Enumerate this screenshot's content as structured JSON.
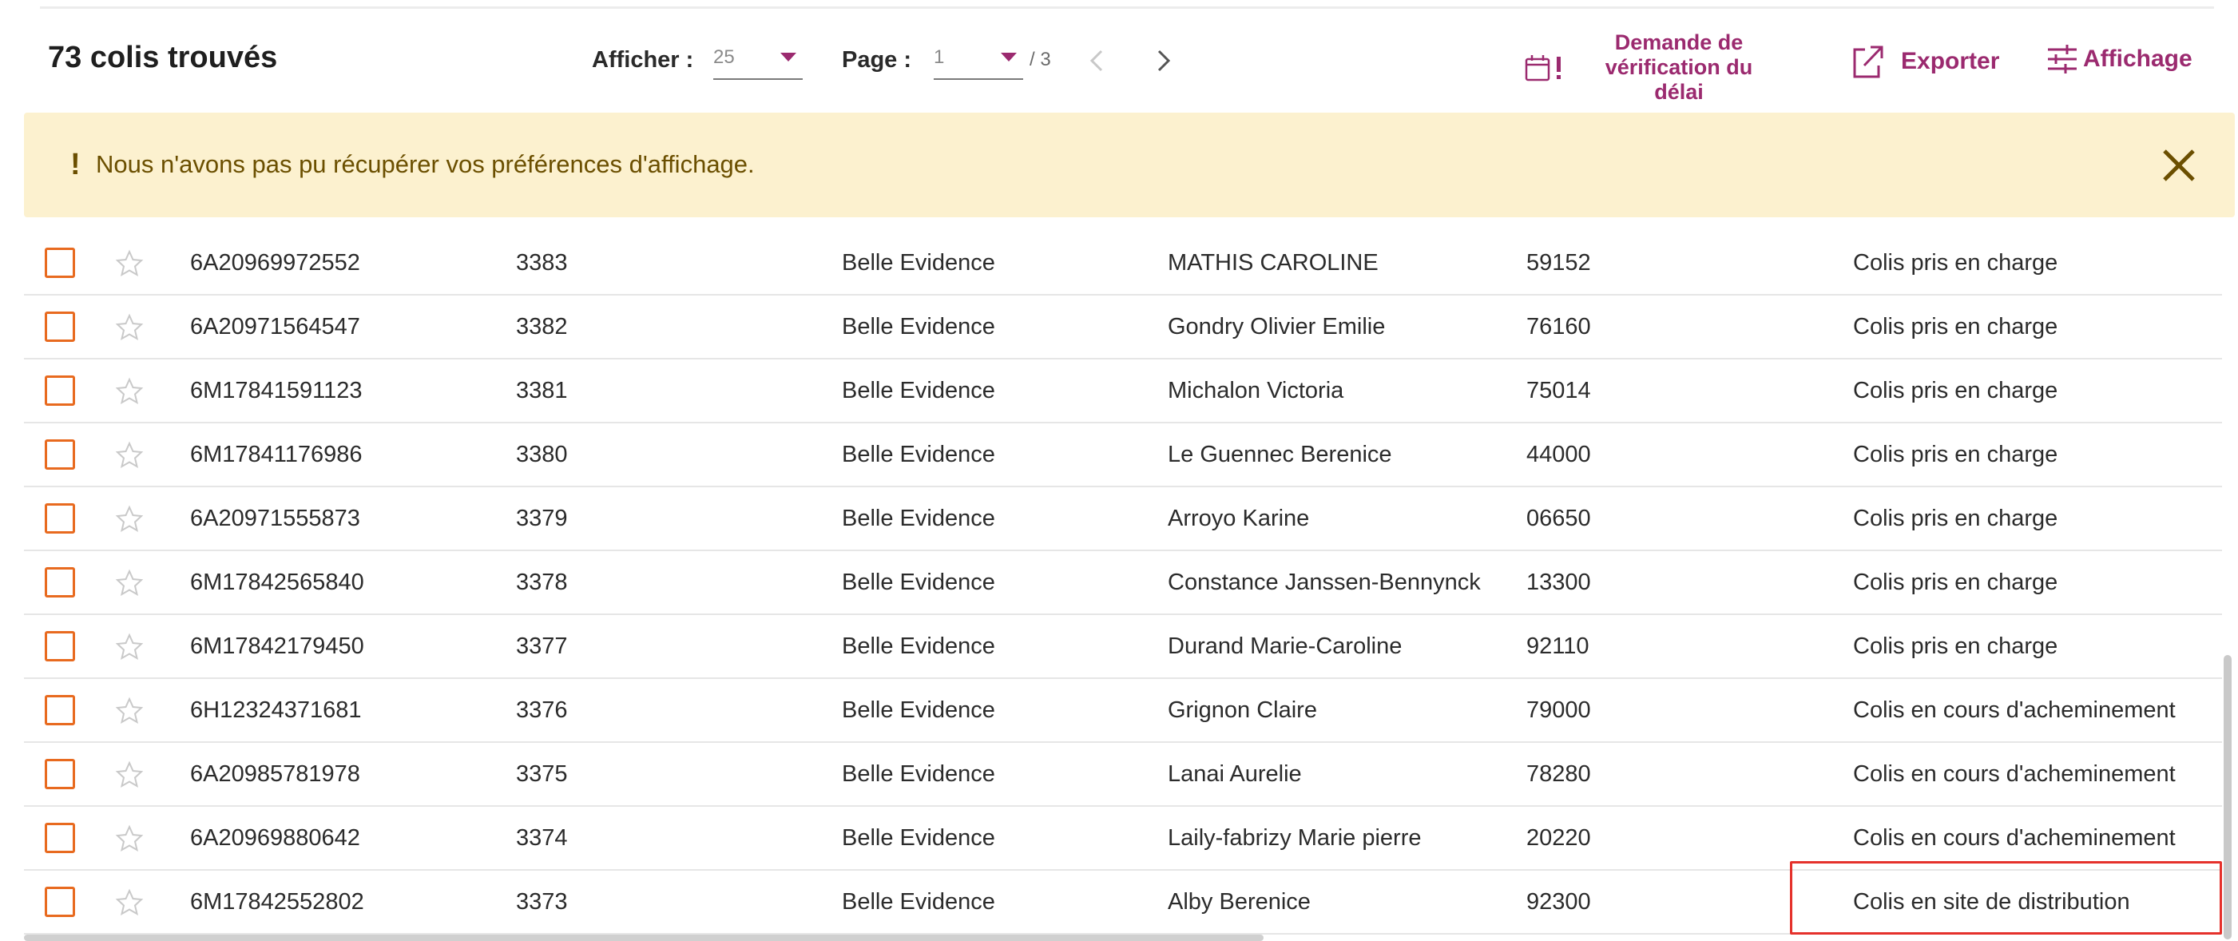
{
  "header": {
    "count_text": "73 colis trouvés",
    "per_page_label": "Afficher :",
    "per_page_value": "25",
    "page_label": "Page :",
    "page_value": "1",
    "page_total": "/ 3",
    "actions": {
      "demande_line1": "Demande de",
      "demande_line2": "vérification du délai",
      "export": "Exporter",
      "display": "Affichage"
    }
  },
  "banner": {
    "icon": "!",
    "message": "Nous n'avons pas pu récupérer vos préférences d'affichage."
  },
  "colors": {
    "accent": "#9b2a6f",
    "checkbox": "#e86a1f",
    "banner_bg": "#fcf1cf",
    "highlight": "#e5312b"
  },
  "rows": [
    {
      "tracking": "6A20969972552",
      "ref": "3383",
      "sender": "Belle Evidence",
      "recipient": "MATHIS CAROLINE",
      "postal": "59152",
      "status": "Colis pris en charge"
    },
    {
      "tracking": "6A20971564547",
      "ref": "3382",
      "sender": "Belle Evidence",
      "recipient": "Gondry Olivier Emilie",
      "postal": "76160",
      "status": "Colis pris en charge"
    },
    {
      "tracking": "6M17841591123",
      "ref": "3381",
      "sender": "Belle Evidence",
      "recipient": "Michalon Victoria",
      "postal": "75014",
      "status": "Colis pris en charge"
    },
    {
      "tracking": "6M17841176986",
      "ref": "3380",
      "sender": "Belle Evidence",
      "recipient": "Le Guennec Berenice",
      "postal": "44000",
      "status": "Colis pris en charge"
    },
    {
      "tracking": "6A20971555873",
      "ref": "3379",
      "sender": "Belle Evidence",
      "recipient": "Arroyo Karine",
      "postal": "06650",
      "status": "Colis pris en charge"
    },
    {
      "tracking": "6M17842565840",
      "ref": "3378",
      "sender": "Belle Evidence",
      "recipient": "Constance Janssen-Bennynck",
      "postal": "13300",
      "status": "Colis pris en charge"
    },
    {
      "tracking": "6M17842179450",
      "ref": "3377",
      "sender": "Belle Evidence",
      "recipient": "Durand Marie-Caroline",
      "postal": "92110",
      "status": "Colis pris en charge"
    },
    {
      "tracking": "6H12324371681",
      "ref": "3376",
      "sender": "Belle Evidence",
      "recipient": "Grignon Claire",
      "postal": "79000",
      "status": "Colis en cours d'acheminement"
    },
    {
      "tracking": "6A20985781978",
      "ref": "3375",
      "sender": "Belle Evidence",
      "recipient": "Lanai Aurelie",
      "postal": "78280",
      "status": "Colis en cours d'acheminement"
    },
    {
      "tracking": "6A20969880642",
      "ref": "3374",
      "sender": "Belle Evidence",
      "recipient": "Laily-fabrizy Marie pierre",
      "postal": "20220",
      "status": "Colis en cours d'acheminement"
    },
    {
      "tracking": "6M17842552802",
      "ref": "3373",
      "sender": "Belle Evidence",
      "recipient": "Alby Berenice",
      "postal": "92300",
      "status": "Colis en site de distribution"
    }
  ]
}
